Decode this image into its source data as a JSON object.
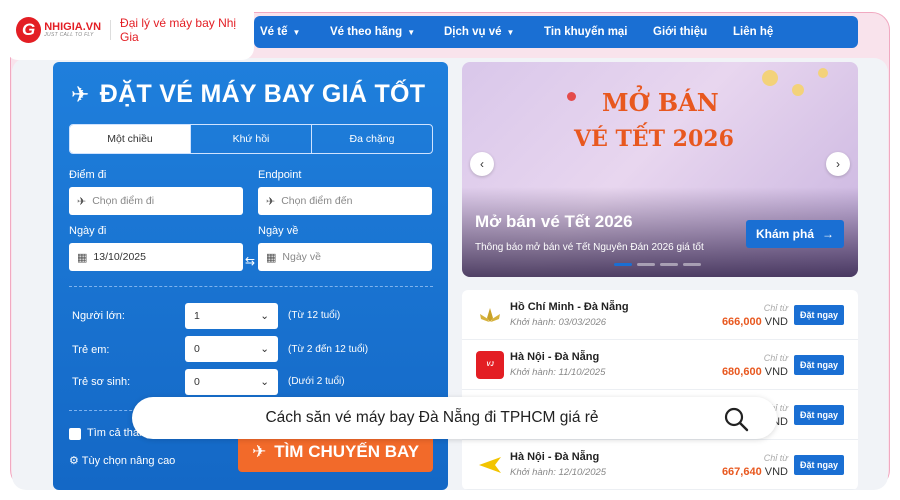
{
  "header": {
    "logo_name": "NHIGIA.VN",
    "logo_tagline": "JUST CALL TO FLY",
    "agency_label": "Đại lý vé máy bay Nhị Gia",
    "nav": [
      {
        "label": "Vé tế",
        "has_dropdown": true
      },
      {
        "label": "Vé theo hãng",
        "has_dropdown": true
      },
      {
        "label": "Dịch vụ vé",
        "has_dropdown": true
      },
      {
        "label": "Tin khuyến mại",
        "has_dropdown": false
      },
      {
        "label": "Giới thiệu",
        "has_dropdown": false
      },
      {
        "label": "Liên hệ",
        "has_dropdown": false
      }
    ]
  },
  "booking": {
    "title": "ĐẶT VÉ MÁY BAY GIÁ TỐT",
    "tabs": [
      "Một chiều",
      "Khứ hồi",
      "Đa chặng"
    ],
    "active_tab": "Một chiều",
    "origin": {
      "label": "Điểm đi",
      "placeholder": "Chọn điểm đi"
    },
    "destination": {
      "label": "Endpoint",
      "placeholder": "Chọn điểm đến"
    },
    "depart_date": {
      "label": "Ngày đi",
      "value": "13/10/2025"
    },
    "return_date": {
      "label": "Ngày về",
      "placeholder": "Ngày về"
    },
    "passengers": [
      {
        "label": "Người lớn:",
        "value": "1",
        "note": "(Từ 12 tuổi)"
      },
      {
        "label": "Trẻ em:",
        "value": "0",
        "note": "(Từ 2 đến 12 tuổi)"
      },
      {
        "label": "Trẻ sơ sinh:",
        "value": "0",
        "note": "(Dưới 2 tuổi)"
      }
    ],
    "cheapest_label": "Tìm cả tháng",
    "advanced_label": "Tùy chọn nâng cao",
    "search_button": "TÌM CHUYẾN BAY"
  },
  "banner": {
    "headline_1": "MỞ BÁN",
    "headline_2": "VÉ TẾT 2026",
    "title": "Mở bán vé Tết 2026",
    "subtitle": "Thông báo mở bán vé Tết Nguyên Đán 2026 giá tốt",
    "cta": "Khám phá",
    "slide_count": 4,
    "active_slide": 1
  },
  "deals": [
    {
      "airline_icon": "lotus-icon",
      "route": "Hồ Chí Minh - Đà Nẵng",
      "depart": "Khởi hành: 03/03/2026",
      "from_label": "Chỉ từ",
      "price": "666,000",
      "currency": "VND",
      "button": "Đặt ngay"
    },
    {
      "airline_icon": "vietjet-icon",
      "route": "Hà Nội - Đà Nẵng",
      "depart": "Khởi hành: 11/10/2025",
      "from_label": "Chỉ từ",
      "price": "680,600",
      "currency": "VND",
      "button": "Đặt ngay"
    },
    {
      "airline_icon": "lotus-icon",
      "route": "",
      "depart": "",
      "from_label": "Chỉ từ",
      "price": "",
      "currency": "VND",
      "button": "Đặt ngay"
    },
    {
      "airline_icon": "bamboo-icon",
      "route": "Hà Nội - Đà Nẵng",
      "depart": "Khởi hành: 12/10/2025",
      "from_label": "Chỉ từ",
      "price": "667,640",
      "currency": "VND",
      "button": "Đặt ngay"
    }
  ],
  "search_bar": {
    "text": "Cách săn vé máy bay Đà Nẵng đi TPHCM giá rẻ",
    "icon": "search-icon"
  },
  "colors": {
    "primary": "#1a6fd3",
    "accent": "#f26a2a",
    "brand_red": "#e31e24",
    "frame": "#f9e3ec"
  }
}
